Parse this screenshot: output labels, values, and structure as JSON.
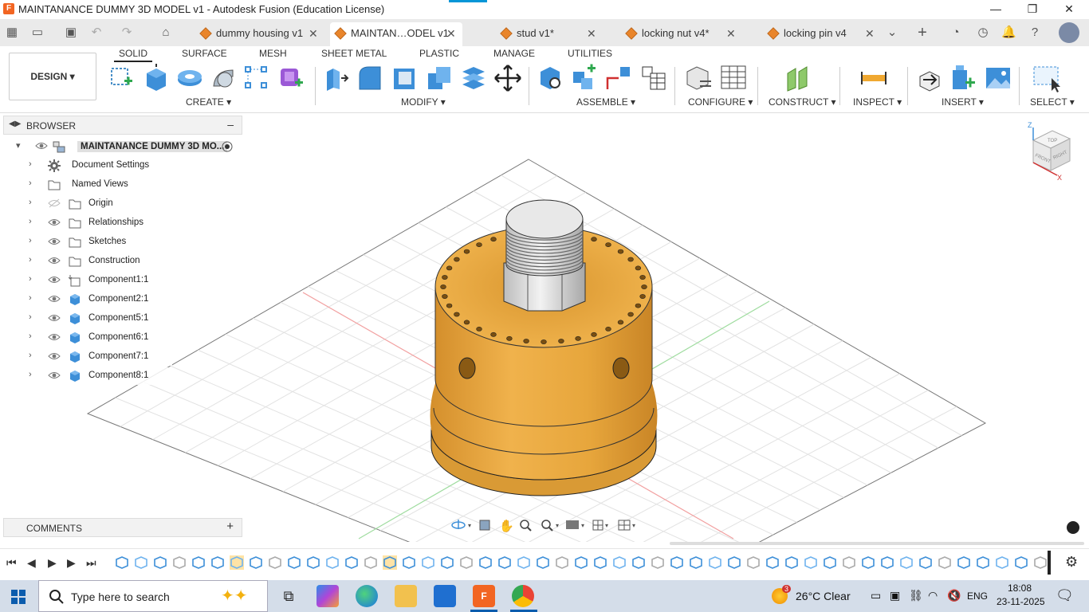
{
  "window": {
    "title": "MAINTANANCE DUMMY 3D MODEL v1 - Autodesk Fusion (Education License)",
    "minimize": "—",
    "maximize": "❐",
    "close": "✕"
  },
  "tabs": [
    {
      "label": "dummy housing v1",
      "active": false
    },
    {
      "label": "MAINTAN…ODEL v1",
      "active": true
    },
    {
      "label": "stud v1*",
      "active": false
    },
    {
      "label": "locking nut v4*",
      "active": false
    },
    {
      "label": "locking pin v4",
      "active": false
    }
  ],
  "ribbon": {
    "workspace": "DESIGN",
    "tabs": [
      "SOLID",
      "SURFACE",
      "MESH",
      "SHEET METAL",
      "PLASTIC",
      "MANAGE",
      "UTILITIES"
    ],
    "active_tab": "SOLID",
    "groups": [
      "CREATE",
      "MODIFY",
      "ASSEMBLE",
      "CONFIGURE",
      "CONSTRUCT",
      "INSPECT",
      "INSERT",
      "SELECT"
    ]
  },
  "browser": {
    "title": "BROWSER",
    "root": "MAINTANANCE DUMMY 3D MO...",
    "items": [
      {
        "label": "Document Settings",
        "icon": "gear-icon"
      },
      {
        "label": "Named Views",
        "icon": "folder-icon"
      },
      {
        "label": "Origin",
        "icon": "folder-icon"
      },
      {
        "label": "Relationships",
        "icon": "folder-icon"
      },
      {
        "label": "Sketches",
        "icon": "folder-icon"
      },
      {
        "label": "Construction",
        "icon": "folder-icon"
      },
      {
        "label": "Component1:1",
        "icon": "component-icon"
      },
      {
        "label": "Component2:1",
        "icon": "body-icon"
      },
      {
        "label": "Component5:1",
        "icon": "body-icon"
      },
      {
        "label": "Component6:1",
        "icon": "body-icon"
      },
      {
        "label": "Component7:1",
        "icon": "body-icon"
      },
      {
        "label": "Component8:1",
        "icon": "body-icon"
      }
    ]
  },
  "comments": {
    "title": "COMMENTS"
  },
  "viewcube": {
    "top": "TOP",
    "front": "FRONT",
    "right": "RIGHT",
    "z": "Z",
    "x": "X"
  },
  "colors": {
    "model": "#e8a53a",
    "model_dark": "#c98a26",
    "accent": "#0696d7"
  },
  "taskbar": {
    "search_placeholder": "Type here to search",
    "weather": "26°C  Clear",
    "lang": "ENG",
    "time": "18:08",
    "date": "23-11-2025",
    "weather_badge": "3"
  }
}
